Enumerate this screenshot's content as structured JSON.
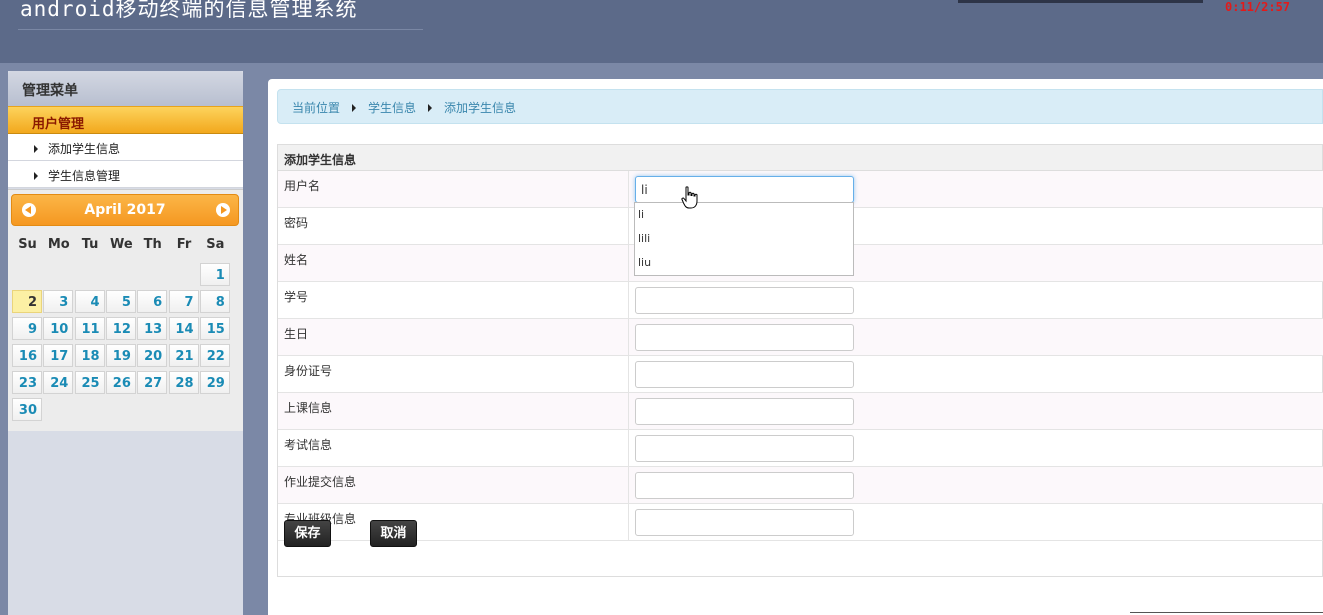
{
  "header": {
    "title": "android移动终端的信息管理系统",
    "timer": "0:11/2:57"
  },
  "sidebar": {
    "menu_title": "管理菜单",
    "group": "用户管理",
    "items": [
      {
        "label": "添加学生信息"
      },
      {
        "label": "学生信息管理"
      }
    ]
  },
  "calendar": {
    "title": "April 2017",
    "weekdays": [
      "Su",
      "Mo",
      "Tu",
      "We",
      "Th",
      "Fr",
      "Sa"
    ],
    "days": [
      "1",
      "2",
      "3",
      "4",
      "5",
      "6",
      "7",
      "8",
      "9",
      "10",
      "11",
      "12",
      "13",
      "14",
      "15",
      "16",
      "17",
      "18",
      "19",
      "20",
      "21",
      "22",
      "23",
      "24",
      "25",
      "26",
      "27",
      "28",
      "29",
      "30"
    ],
    "today": "2"
  },
  "breadcrumb": [
    "当前位置",
    "学生信息",
    "添加学生信息"
  ],
  "form": {
    "title": "添加学生信息",
    "fields": [
      {
        "label": "用户名",
        "value": "li"
      },
      {
        "label": "密码",
        "value": ""
      },
      {
        "label": "姓名",
        "value": ""
      },
      {
        "label": "学号",
        "value": ""
      },
      {
        "label": "生日",
        "value": ""
      },
      {
        "label": "身份证号",
        "value": ""
      },
      {
        "label": "上课信息",
        "value": ""
      },
      {
        "label": "考试信息",
        "value": ""
      },
      {
        "label": "作业提交信息",
        "value": ""
      },
      {
        "label": "专业班级信息",
        "value": ""
      }
    ],
    "save_label": "保存",
    "cancel_label": "取消"
  },
  "autocomplete": [
    "li",
    "lili",
    "liu"
  ]
}
